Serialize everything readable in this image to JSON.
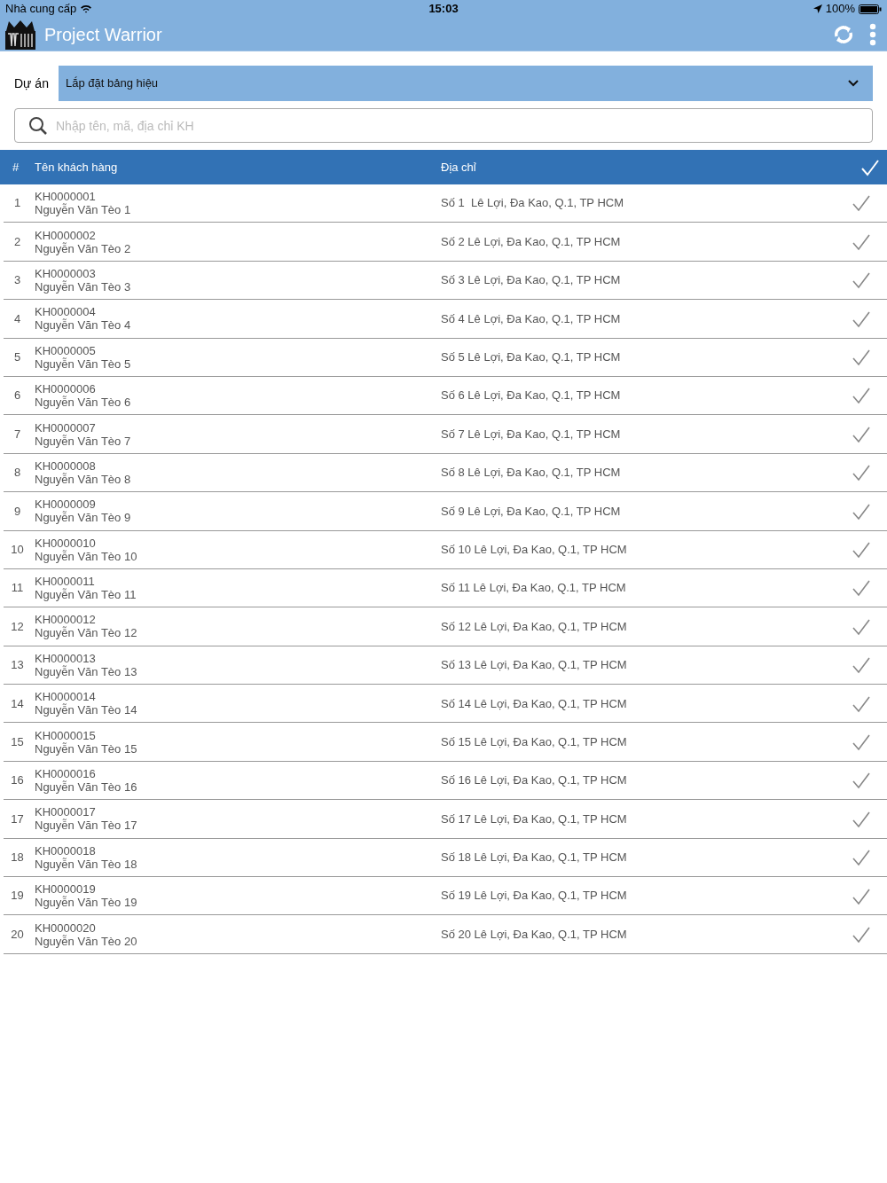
{
  "status_bar": {
    "carrier": "Nhà cung cấp",
    "time": "15:03",
    "battery": "100%"
  },
  "app_bar": {
    "title": "Project Warrior"
  },
  "project": {
    "label": "Dự án",
    "value": "Lắp đặt bảng hiệu"
  },
  "search": {
    "placeholder": "Nhập tên, mã, địa chỉ KH"
  },
  "table": {
    "columns": [
      "#",
      "Tên khách hàng",
      "Địa chỉ"
    ],
    "rows": [
      {
        "index": "1",
        "code": "KH0000001",
        "name": "Nguyễn Văn Tèo 1",
        "address": "Số 1  Lê Lợi, Đa Kao, Q.1, TP HCM"
      },
      {
        "index": "2",
        "code": "KH0000002",
        "name": "Nguyễn Văn Tèo 2",
        "address": "Số 2 Lê Lợi, Đa Kao, Q.1, TP HCM"
      },
      {
        "index": "3",
        "code": "KH0000003",
        "name": "Nguyễn Văn Tèo 3",
        "address": "Số 3 Lê Lợi, Đa Kao, Q.1, TP HCM"
      },
      {
        "index": "4",
        "code": "KH0000004",
        "name": "Nguyễn Văn Tèo 4",
        "address": "Số 4 Lê Lợi, Đa Kao, Q.1, TP HCM"
      },
      {
        "index": "5",
        "code": "KH0000005",
        "name": "Nguyễn Văn Tèo 5",
        "address": "Số 5 Lê Lợi, Đa Kao, Q.1, TP HCM"
      },
      {
        "index": "6",
        "code": "KH0000006",
        "name": "Nguyễn Văn Tèo 6",
        "address": "Số 6 Lê Lợi, Đa Kao, Q.1, TP HCM"
      },
      {
        "index": "7",
        "code": "KH0000007",
        "name": "Nguyễn Văn Tèo 7",
        "address": "Số 7 Lê Lợi, Đa Kao, Q.1, TP HCM"
      },
      {
        "index": "8",
        "code": "KH0000008",
        "name": "Nguyễn Văn Tèo 8",
        "address": "Số 8 Lê Lợi, Đa Kao, Q.1, TP HCM"
      },
      {
        "index": "9",
        "code": "KH0000009",
        "name": "Nguyễn Văn Tèo 9",
        "address": "Số 9 Lê Lợi, Đa Kao, Q.1, TP HCM"
      },
      {
        "index": "10",
        "code": "KH0000010",
        "name": "Nguyễn Văn Tèo 10",
        "address": "Số 10 Lê Lợi, Đa Kao, Q.1, TP HCM"
      },
      {
        "index": "11",
        "code": "KH0000011",
        "name": "Nguyễn Văn Tèo 11",
        "address": "Số 11 Lê Lợi, Đa Kao, Q.1, TP HCM"
      },
      {
        "index": "12",
        "code": "KH0000012",
        "name": "Nguyễn Văn Tèo 12",
        "address": "Số 12 Lê Lợi, Đa Kao, Q.1, TP HCM"
      },
      {
        "index": "13",
        "code": "KH0000013",
        "name": "Nguyễn Văn Tèo 13",
        "address": "Số 13 Lê Lợi, Đa Kao, Q.1, TP HCM"
      },
      {
        "index": "14",
        "code": "KH0000014",
        "name": "Nguyễn Văn Tèo 14",
        "address": "Số 14 Lê Lợi, Đa Kao, Q.1, TP HCM"
      },
      {
        "index": "15",
        "code": "KH0000015",
        "name": "Nguyễn Văn Tèo 15",
        "address": "Số 15 Lê Lợi, Đa Kao, Q.1, TP HCM"
      },
      {
        "index": "16",
        "code": "KH0000016",
        "name": "Nguyễn Văn Tèo 16",
        "address": "Số 16 Lê Lợi, Đa Kao, Q.1, TP HCM"
      },
      {
        "index": "17",
        "code": "KH0000017",
        "name": "Nguyễn Văn Tèo 17",
        "address": "Số 17 Lê Lợi, Đa Kao, Q.1, TP HCM"
      },
      {
        "index": "18",
        "code": "KH0000018",
        "name": "Nguyễn Văn Tèo 18",
        "address": "Số 18 Lê Lợi, Đa Kao, Q.1, TP HCM"
      },
      {
        "index": "19",
        "code": "KH0000019",
        "name": "Nguyễn Văn Tèo 19",
        "address": "Số 19 Lê Lợi, Đa Kao, Q.1, TP HCM"
      },
      {
        "index": "20",
        "code": "KH0000020",
        "name": "Nguyễn Văn Tèo 20",
        "address": "Số 20 Lê Lợi, Đa Kao, Q.1, TP HCM"
      }
    ]
  }
}
